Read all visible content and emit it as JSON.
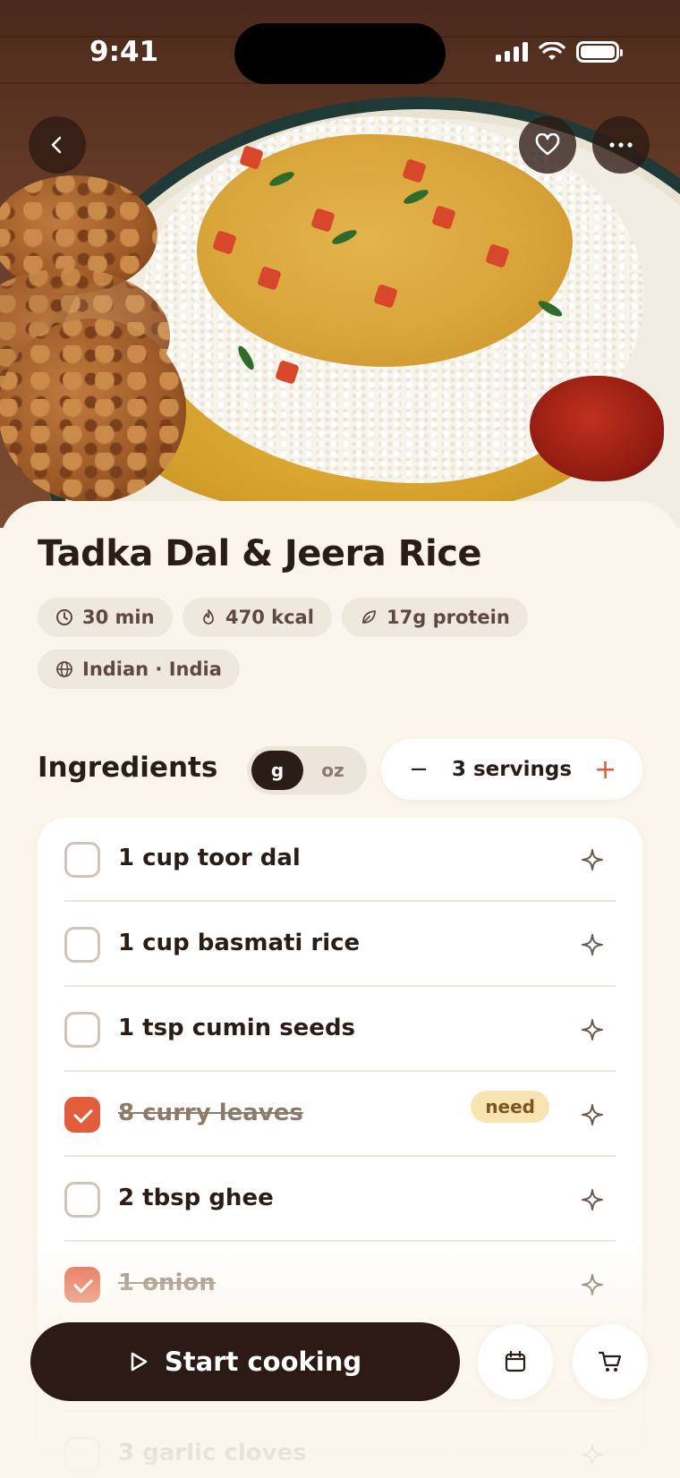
{
  "status_bar": {
    "time": "9:41"
  },
  "recipe": {
    "title": "Tadka Dal & Jeera Rice",
    "meta": {
      "time": "30 min",
      "calories": "470 kcal",
      "protein": "17g protein",
      "cuisine": "Indian · India"
    }
  },
  "ingredients": {
    "section_title": "Ingredients",
    "units": {
      "metric": "g",
      "imperial": "oz",
      "selected": "g"
    },
    "servings_label": "3 servings",
    "items": [
      {
        "text": "1 cup toor dal",
        "checked": false
      },
      {
        "text": "1 cup basmati rice",
        "checked": false
      },
      {
        "text": "1 tsp cumin seeds",
        "checked": false
      },
      {
        "text": "8 curry leaves",
        "checked": true,
        "badge": "need"
      },
      {
        "text": "2 tbsp ghee",
        "checked": false
      },
      {
        "text": "1 onion",
        "checked": true
      },
      {
        "text": "",
        "checked": false
      },
      {
        "text": "3 garlic cloves",
        "checked": false
      }
    ]
  },
  "actions": {
    "start_cooking": "Start cooking"
  },
  "colors": {
    "accent": "#e15d3c",
    "dark": "#2b1a15",
    "background": "#fbf5eb",
    "badge": "#f8e4b0"
  }
}
